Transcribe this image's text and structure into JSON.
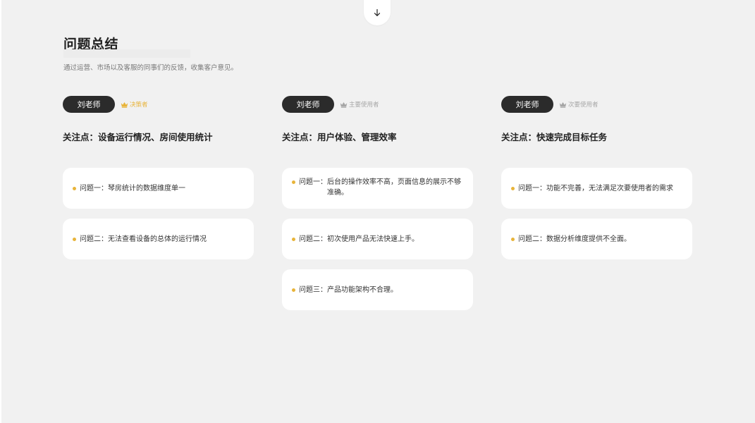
{
  "header": {
    "title": "问题总结",
    "subtitle": "通过运营、市场以及客服的同事们的反馈，收集客户意见。",
    "scroll_icon": "arrow-down-icon"
  },
  "colors": {
    "accent": "#e8b43a",
    "pill_bg": "#2b2b2b",
    "muted": "#a6a6a6",
    "page_bg": "#f1f1f1"
  },
  "personas": [
    {
      "name": "刘老师",
      "role": "决策者",
      "role_icon": "crown-icon",
      "focus": "关注点：设备运行情况、房间使用统计",
      "issues": [
        {
          "label": "问题一：",
          "text": "琴房统计的数据维度单一"
        },
        {
          "label": "问题二：",
          "text": "无法查看设备的总体的运行情况"
        }
      ]
    },
    {
      "name": "刘老师",
      "role": "主要使用者",
      "role_icon": "crown-icon",
      "focus": "关注点：用户体验、管理效率",
      "issues": [
        {
          "label": "问题一：",
          "text": "后台的操作效率不高，页面信息的展示不够准确。"
        },
        {
          "label": "问题二：",
          "text": "初次使用产品无法快速上手。"
        },
        {
          "label": "问题三：",
          "text": "产品功能架构不合理。"
        }
      ]
    },
    {
      "name": "刘老师",
      "role": "次要使用者",
      "role_icon": "crown-icon",
      "focus": "关注点：快速完成目标任务",
      "issues": [
        {
          "label": "问题一：",
          "text": "功能不完善，无法满足次要使用者的需求"
        },
        {
          "label": "问题二：",
          "text": "数据分析维度提供不全面。"
        }
      ]
    }
  ]
}
